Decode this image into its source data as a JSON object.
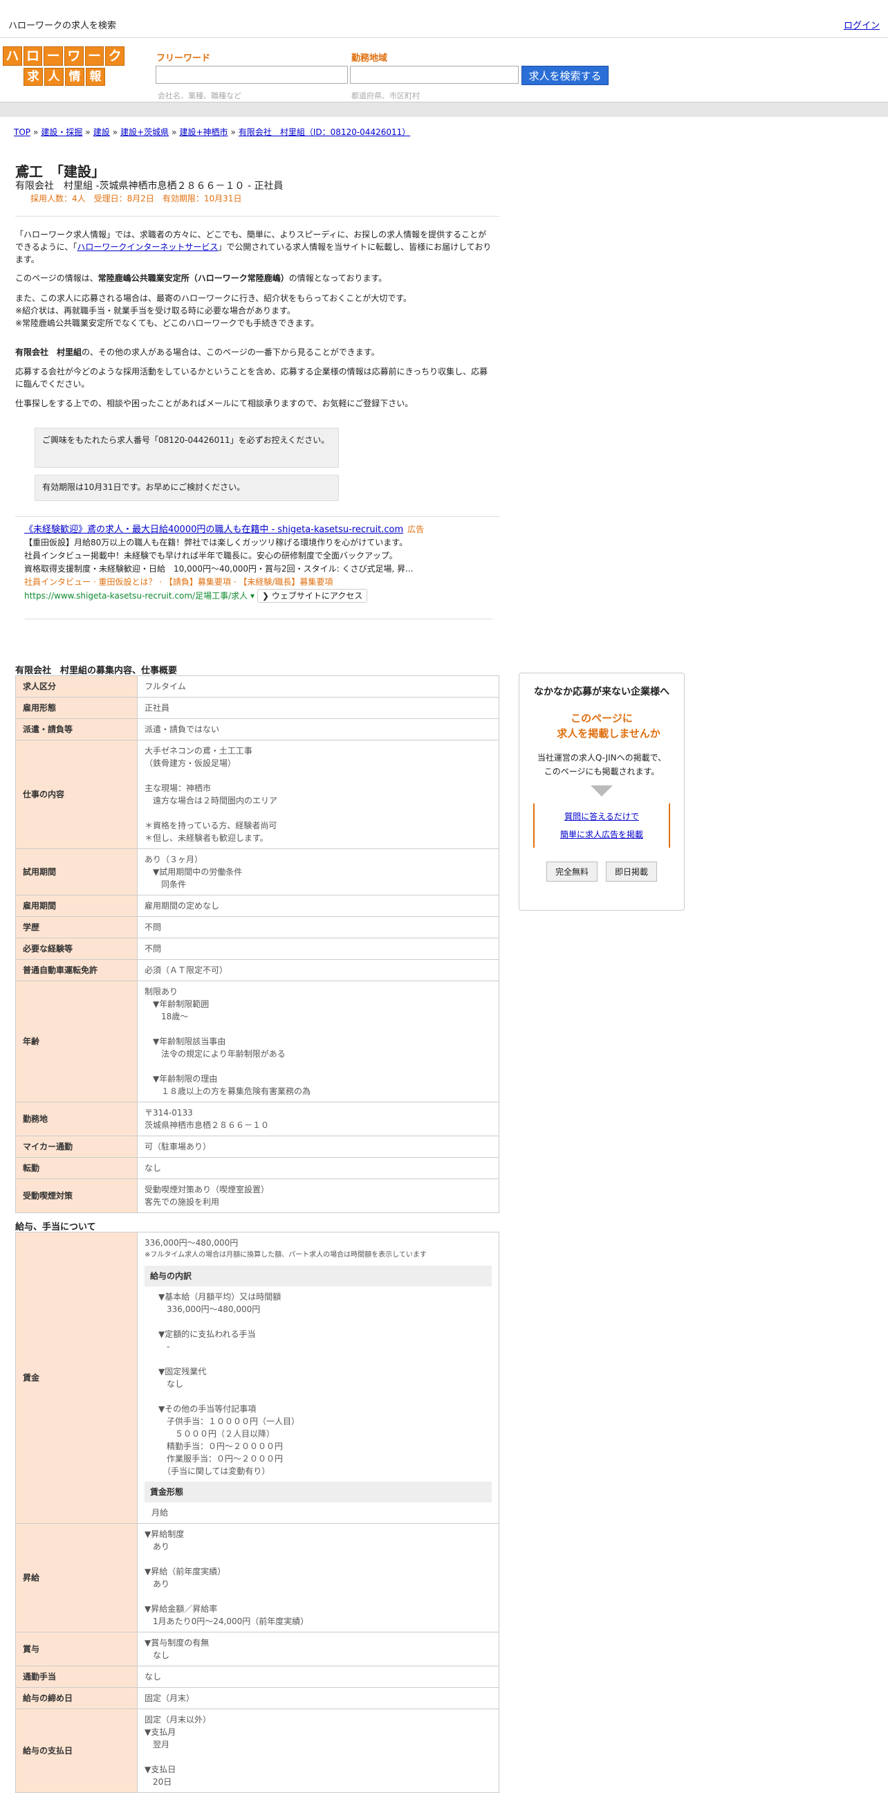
{
  "topbar": {
    "title": "ハローワークの求人を検索",
    "login": "ログイン"
  },
  "logo": {
    "row1": [
      "ハ",
      "ロ",
      "ー",
      "ワ",
      "ー",
      "ク"
    ],
    "row2": [
      "求",
      "人",
      "情",
      "報"
    ]
  },
  "search": {
    "keyword_label": "フリーワード",
    "keyword_hint": "会社名、業種、職種など",
    "area_label": "勤務地域",
    "area_hint": "都道府県、市区町村",
    "button": "求人を検索する"
  },
  "breadcrumb": [
    "TOP",
    "建設・採掘",
    "建設",
    "建設+茨城県",
    "建設+神栖市",
    "有限会社　村里組（ID：08120-04426011）"
  ],
  "job": {
    "title": "鳶工　「建設」",
    "subtitle": "有限会社　村里組 -茨城県神栖市息栖２８６６－１０ - 正社員",
    "meta": "採用人数：4人　受理日：8月2日　有効期限：10月31日"
  },
  "intro": {
    "p1_a": "「ハローワーク求人情報」では、求職者の方々に、どこでも、簡単に、よりスピーディに、お探しの求人情報を提供することができるように、「",
    "p1_link": "ハローワークインターネットサービス",
    "p1_b": "」で公開されている求人情報を当サイトに転載し、皆様にお届けしております。",
    "p2_a": "このページの情報は、",
    "p2_b": "常陸鹿嶋公共職業安定所（ハローワーク常陸鹿嶋）",
    "p2_c": "の情報となっております。",
    "p3_1": "また、この求人に応募される場合は、最寄のハローワークに行き、紹介状をもらっておくことが大切です。",
    "p3_2": "※紹介状は、再就職手当・就業手当を受け取る時に必要な場合があります。",
    "p3_3": "※常陸鹿嶋公共職業安定所でなくても、どこのハローワークでも手続きできます。",
    "p4_a": "有限会社　村里組",
    "p4_b": "の、その他の求人がある場合は、このページの一番下から見ることができます。",
    "p5": "応募する会社が今どのような採用活動をしているかということを含め、応募する企業様の情報は応募前にきっちり収集し、応募に臨んでください。",
    "p6": "仕事探しをする上での、相談や困ったことがあればメールにて相談承りますので、お気軽にご登録下さい。"
  },
  "notes": {
    "n1": "ご興味をもたれたら求人番号「08120-04426011」を必ずお控えください。",
    "n2": "有効期限は10月31日です。お早めにご検討ください。"
  },
  "ad": {
    "title": "《未経験歓迎》鳶の求人・最大日給40000円の職人も在籍中 - shigeta-kasetsu-recruit.com",
    "tag": "広告",
    "l1": "【重田仮設】月給80万以上の職人も在籍！弊社では楽しくガッツリ稼げる環境作りを心がけています。",
    "l2": "社員インタビュー掲載中！未経験でも早ければ半年で職長に。安心の研修制度で全面バックアップ。",
    "l3": "資格取得支援制度・未経験歓迎・日給　10,000円～40,000円・賞与2回・スタイル: くさび式足場, 昇...",
    "sublinks": "社員インタビュー · 重田仮設とは？ · 【請負】募集要項 · 【未経験/職長】募集要項",
    "url": "https://www.shigeta-kasetsu-recruit.com/足場工事/求人",
    "visit": "❯ ウェブサイトにアクセス"
  },
  "section1": {
    "heading": "有限会社　村里組の募集内容、仕事概要",
    "rows": [
      {
        "k": "求人区分",
        "v": [
          "フルタイム"
        ]
      },
      {
        "k": "雇用形態",
        "v": [
          "正社員"
        ]
      },
      {
        "k": "派遣・請負等",
        "v": [
          "派遣・請負ではない"
        ]
      },
      {
        "k": "仕事の内容",
        "v": [
          "大手ゼネコンの鳶・土工工事",
          "（鉄骨建方・仮設足場）",
          "",
          "主な現場：神栖市",
          "　遠方な場合は２時間圏内のエリア",
          "",
          "＊資格を持っている方、経験者尚可",
          "＊但し、未経験者も歓迎します。"
        ]
      },
      {
        "k": "試用期間",
        "v": [
          "あり（３ヶ月）",
          "　▼試用期間中の労働条件",
          "　　同条件"
        ]
      },
      {
        "k": "雇用期間",
        "v": [
          "雇用期間の定めなし"
        ]
      },
      {
        "k": "学歴",
        "v": [
          "不問"
        ]
      },
      {
        "k": "必要な経験等",
        "v": [
          "不問"
        ]
      },
      {
        "k": "普通自動車運転免許",
        "v": [
          "必須（ＡＴ限定不可）"
        ]
      },
      {
        "k": "年齢",
        "v": [
          "制限あり",
          "　▼年齢制限範囲",
          "　　18歳～",
          "",
          "　▼年齢制限該当事由",
          "　　法令の規定により年齢制限がある",
          "",
          "　▼年齢制限の理由",
          "　　１８歳以上の方を募集危険有害業務の為"
        ]
      },
      {
        "k": "勤務地",
        "v": [
          "〒314-0133",
          "茨城県神栖市息栖２８６６－１０"
        ]
      },
      {
        "k": "マイカー通勤",
        "v": [
          "可（駐車場あり）"
        ]
      },
      {
        "k": "転勤",
        "v": [
          "なし"
        ]
      },
      {
        "k": "受動喫煙対策",
        "v": [
          "受動喫煙対策あり（喫煙室設置）",
          "客先での施設を利用"
        ]
      }
    ]
  },
  "section2": {
    "heading": "給与、手当について",
    "wage": {
      "k": "賃金",
      "range": "336,000円〜480,000円",
      "note": "※フルタイム求人の場合は月額に換算した額、パート求人の場合は時間額を表示しています",
      "breakdown_head": "給与の内訳",
      "breakdown": [
        "▼基本給（月額平均）又は時間額",
        "　336,000円〜480,000円",
        "",
        "▼定額的に支払われる手当",
        "　-",
        "",
        "▼固定残業代",
        "　なし",
        "",
        "▼その他の手当等付記事項",
        "　子供手当：１００００円（一人目）",
        "　　５０００円（２人目以降）",
        "　精勤手当：０円～２００００円",
        "　作業服手当：０円～２０００円",
        "　（手当に関しては変動有り）"
      ],
      "form_head": "賃金形態",
      "form": "月給"
    },
    "rows": [
      {
        "k": "昇給",
        "v": [
          "▼昇給制度",
          "　あり",
          "",
          "▼昇給（前年度実績）",
          "　あり",
          "",
          "▼昇給金額／昇給率",
          "　1月あたり0円〜24,000円（前年度実績）"
        ]
      },
      {
        "k": "賞与",
        "v": [
          "▼賞与制度の有無",
          "　なし"
        ]
      },
      {
        "k": "通勤手当",
        "v": [
          "なし"
        ]
      },
      {
        "k": "給与の締め日",
        "v": [
          "固定（月末）"
        ]
      },
      {
        "k": "給与の支払日",
        "v": [
          "固定（月末以外）",
          "▼支払月",
          "　翌月",
          "",
          "▼支払日",
          "　20日"
        ]
      }
    ]
  },
  "sidebox": {
    "heading": "なかなか応募が来ない企業様へ",
    "orange1": "このページに",
    "orange2": "求人を掲載しませんか",
    "p1": "当社運営の求人Q-JINへの掲載で、",
    "p2": "このページにも掲載されます。",
    "link1": "質問に答えるだけで",
    "link2": "簡単に求人広告を掲載",
    "btn1": "完全無料",
    "btn2": "即日掲載"
  }
}
